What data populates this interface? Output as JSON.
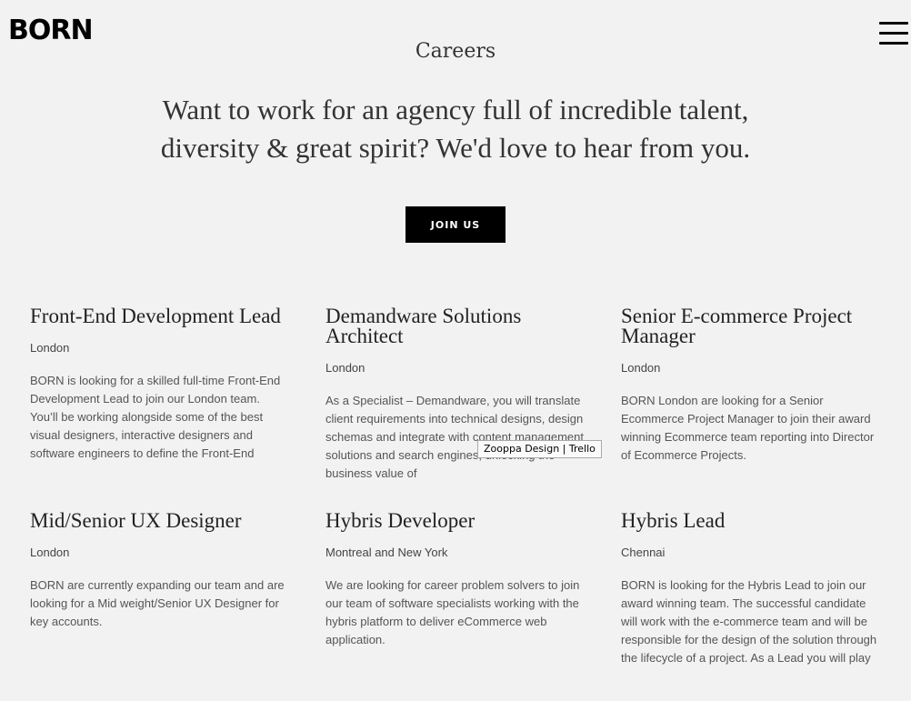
{
  "brand": {
    "logo_text": "BORN"
  },
  "header": {
    "menu_label": "menu"
  },
  "hero": {
    "title": "Careers",
    "headline": "Want to work for an agency full of incredible talent, diversity & great spirit? We'd love to hear from you.",
    "join_label": "JOIN US"
  },
  "jobs": [
    {
      "title": "Front-End Development Lead",
      "location": "London",
      "description": "BORN is looking for a skilled full-time Front-End Development Lead to join our London team.\nYou’ll be working alongside some of the best visual designers, interactive designers and software engineers to define the Front-End"
    },
    {
      "title": "Demandware Solutions Architect",
      "location": "London",
      "description": "As a Specialist – Demandware, you will translate client requirements into technical designs, design schemas and integrate with content management solutions and search engines, unlocking the business value of"
    },
    {
      "title": "Senior E-commerce Project Manager",
      "location": "London",
      "description": "BORN London are looking for a Senior Ecommerce Project Manager to join their award winning Ecommerce team reporting into Director of Ecommerce Projects."
    },
    {
      "title": "Mid/Senior UX Designer",
      "location": "London",
      "description": "BORN are currently expanding our team and are looking for a Mid weight/Senior UX Designer for key accounts."
    },
    {
      "title": "Hybris Developer",
      "location": "Montreal and New York",
      "description": "We are looking for career problem solvers to join our team of software specialists working with the hybris platform to deliver eCommerce web application."
    },
    {
      "title": "Hybris Lead",
      "location": "Chennai",
      "description": "BORN is looking for the Hybris Lead to join our award winning team. The successful candidate will work with the e-commerce team and will be responsible for the design of the solution through the lifecycle of a project. As a Lead you will play a key role in driving forward"
    }
  ],
  "tooltip": {
    "text": "Zooppa Design | Trello"
  }
}
